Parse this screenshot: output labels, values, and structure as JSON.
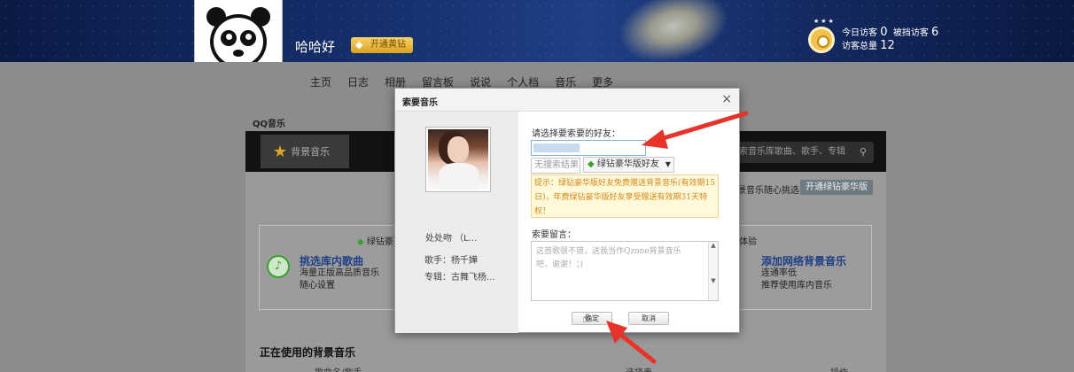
{
  "profile": {
    "username": "哈哈好",
    "vip_badge": "开通黄钻"
  },
  "visitors": {
    "today_label": "今日访客",
    "today_count": "0",
    "blocked_label": "被挡访客",
    "blocked_count": "6",
    "total_label": "访客总量",
    "total_count": "12"
  },
  "nav": [
    "主页",
    "日志",
    "相册",
    "留言板",
    "说说",
    "个人档",
    "音乐",
    "更多"
  ],
  "music_page": {
    "section_title": "QQ音乐",
    "bg_music_tab": "背景音乐",
    "search_placeholder": "索音乐库歌曲、歌手、专辑",
    "select_hint": "景音乐随心挑选",
    "open_green_button": "开通绿钻豪华版",
    "green_title": "绿钻豪",
    "right_title": "体验",
    "card_left": {
      "title": "挑选库内歌曲",
      "line1": "海量正版高品质音乐",
      "line2": "随心设置"
    },
    "card_right": {
      "title": "添加网络背景音乐",
      "line1": "连通率低",
      "line2": "推荐使用库内音乐"
    },
    "using_title": "正在使用的背景音乐",
    "table_headers": [
      "歌曲名/歌手",
      "选择表",
      "操作"
    ]
  },
  "dialog": {
    "title": "索要音乐",
    "close": "×",
    "song_name": "处处吻 （L...",
    "singer": "歌手：杨千嬅",
    "album": "专辑：古舞飞杨...",
    "select_friend_label": "请选择要索要的好友：",
    "filter_placeholder": "无搜索结果",
    "filter_option": "绿钻豪华版好友",
    "tip": "提示：绿钻豪华版好友免费赠送背景音乐(有效期15日)，年费绿钻豪华版好友享受赠送有效期31天特权！",
    "message_label": "索要留言：",
    "message_placeholder": "这首歌很不错，送我当作Qzone背景音乐吧，谢谢！；)",
    "confirm_button": "确定",
    "cancel_button": "取消"
  },
  "colors": {
    "banner": "#16306d",
    "annotation_arrow": "#e8332a",
    "tip_text": "#d28a1c"
  }
}
